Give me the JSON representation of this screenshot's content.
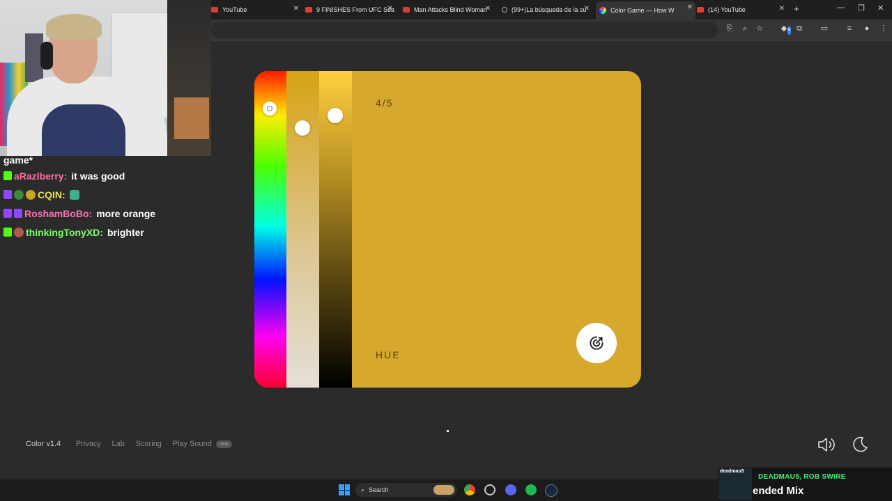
{
  "browser": {
    "tabs": [
      {
        "title": "YouTube",
        "favicon": "youtube-icon"
      },
      {
        "title": "9 FINISHES From UFC Sea",
        "favicon": "youtube-icon"
      },
      {
        "title": "Man Attacks Blind Woman",
        "favicon": "youtube-icon"
      },
      {
        "title": "(99+)La búsqueda de la su",
        "favicon": "tiktok-icon"
      },
      {
        "title": "Color Game — How W",
        "favicon": "color-wheel-icon",
        "active": true
      },
      {
        "title": "(14) YouTube",
        "favicon": "youtube-icon"
      }
    ],
    "new_tab_label": "+",
    "extension_badge": "6"
  },
  "chat": {
    "partial_line": "game*",
    "messages": [
      {
        "user": "aRazlberry:",
        "text": "it was good",
        "user_color": "#ff6fa3",
        "badge": "kick"
      },
      {
        "user": "CQIN:",
        "text": "",
        "user_color": "#f0e04a",
        "badge": "twitch"
      },
      {
        "user": "RoshamBoBo:",
        "text": "more orange",
        "user_color": "#ff6fb8",
        "badge": "twitch"
      },
      {
        "user": "thinkingTonyXD:",
        "text": "brighter",
        "user_color": "#7dff6a",
        "badge": "kick"
      }
    ]
  },
  "game": {
    "progress": "4/5",
    "mode_label": "HUE",
    "swatch_color": "#d6a82e",
    "submit_icon": "target-arrow-icon"
  },
  "footer": {
    "brand": "Color v1.4",
    "links": [
      "Privacy",
      "Lab",
      "Scoring",
      "Play Sound"
    ],
    "pill": "new"
  },
  "taskbar": {
    "search_placeholder": "Search"
  },
  "now_playing": {
    "art_label": "deadmau5",
    "artist": "DEADMAU5, ROB SWIRE",
    "track": "ended Mix"
  }
}
